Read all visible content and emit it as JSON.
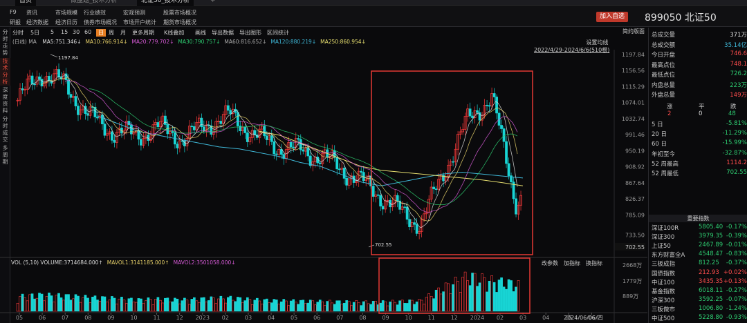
{
  "tabs": [
    {
      "label": "首页",
      "active": true
    },
    {
      "label": "做盘题_技术分析",
      "active": false
    },
    {
      "label": "北证50_技术分析",
      "active": true
    }
  ],
  "menu": {
    "row1": [
      "F9",
      "资讯",
      "市场规模",
      "行业绩效",
      "宏观预测",
      "股票市场概况"
    ],
    "row2": [
      "研报",
      "经济数据",
      "经济日历",
      "债券市场概况",
      "市场开户统计",
      "期货市场概况"
    ]
  },
  "header": {
    "add_label": "加入自选",
    "code": "899050",
    "name": "北证50"
  },
  "left_nav": [
    "分时走势",
    "技术分析",
    "深度资料",
    "分时成交",
    "多周期"
  ],
  "left_nav_active": "技术分析",
  "toolbar": {
    "periods": [
      "分时",
      "5日",
      "5",
      "15",
      "30",
      "60",
      "日",
      "周",
      "月",
      "更多周期",
      "K线叠加",
      "画线",
      "导出数据",
      "导出图形",
      "区间统计"
    ],
    "selected": "日",
    "right": "简约版面"
  },
  "ma_legend": {
    "tag": "(日线) MA",
    "items": [
      {
        "label": "MA5:751.346↓",
        "color": "#dddddd"
      },
      {
        "label": "MA10:766.914↓",
        "color": "#e8d26a"
      },
      {
        "label": "MA20:779.702↓",
        "color": "#d65ad6"
      },
      {
        "label": "MA30:790.757↓",
        "color": "#2ecc71"
      },
      {
        "label": "MA60:816.652↓",
        "color": "#aaaaaa"
      },
      {
        "label": "MA120:880.219↓",
        "color": "#3fb8d8"
      },
      {
        "label": "MA250:860.954↓",
        "color": "#e8e070"
      }
    ]
  },
  "range": {
    "setting": "设置均线",
    "label": "2022/4/29-2024/6/6(510根)"
  },
  "price_axis": [
    "1197.84",
    "1156.56",
    "1115.29",
    "1074.01",
    "1032.74",
    "991.46",
    "950.19",
    "908.92",
    "867.64",
    "826.37",
    "785.09",
    "733.50",
    "702.55"
  ],
  "annotations": {
    "high": "1197.84",
    "low": "702.55"
  },
  "x_axis": [
    "05",
    "06",
    "07",
    "08",
    "09",
    "10",
    "11",
    "12",
    "2023",
    "02",
    "03",
    "04",
    "05",
    "06",
    "07",
    "08",
    "09",
    "10",
    "11",
    "12",
    "2024",
    "02",
    "03",
    "04",
    "05",
    "06"
  ],
  "volume": {
    "legend": [
      {
        "label": "VOL (5,10) VOLUME:3714684.000↑",
        "color": "#dddddd"
      },
      {
        "label": "MAVOL1:3141185.000↑",
        "color": "#e8d26a"
      },
      {
        "label": "MAVOL2:3501058.000↓",
        "color": "#d65ad6"
      }
    ],
    "buttons": [
      "改参数",
      "加指标",
      "换指标"
    ],
    "axis": [
      "2668万",
      "1779万",
      "889万"
    ],
    "date": "2024/06/06/四"
  },
  "quote": [
    {
      "label": "总成交量",
      "value": "371万",
      "color": "#dddddd"
    },
    {
      "label": "总成交额",
      "value": "35.14亿",
      "color": "#3fb8d8"
    },
    {
      "label": "今日开盘",
      "value": "746.6",
      "color": "#ff4d4d"
    },
    {
      "label": "最高点位",
      "value": "748.1",
      "color": "#ff4d4d"
    },
    {
      "label": "最低点位",
      "value": "726.2",
      "color": "#2ecc71"
    },
    {
      "label": "内盘总量",
      "value": "223万",
      "color": "#2ecc71"
    },
    {
      "label": "外盘总量",
      "value": "149万",
      "color": "#ff4d4d"
    }
  ],
  "breadth": {
    "headers": [
      "涨",
      "平",
      "跌"
    ],
    "values": [
      "2",
      "0",
      "48"
    ]
  },
  "perf": [
    {
      "label": "5 日",
      "value": "-5.81%",
      "color": "#2ecc71"
    },
    {
      "label": "20 日",
      "value": "-11.29%",
      "color": "#2ecc71"
    },
    {
      "label": "60 日",
      "value": "-15.99%",
      "color": "#2ecc71"
    },
    {
      "label": "年初至今",
      "value": "-32.87%",
      "color": "#2ecc71"
    },
    {
      "label": "52 周最高",
      "value": "1114.2",
      "color": "#ff4d4d"
    },
    {
      "label": "52 周最低",
      "value": "702.55",
      "color": "#2ecc71"
    }
  ],
  "indices_header": "重要指数",
  "indices": [
    {
      "name": "深证100R",
      "price": "5805.40",
      "chg": "-0.17%",
      "color": "#2ecc71"
    },
    {
      "name": "深证300",
      "price": "3979.35",
      "chg": "-0.39%",
      "color": "#2ecc71"
    },
    {
      "name": "上证50",
      "price": "2467.89",
      "chg": "-0.01%",
      "color": "#2ecc71"
    },
    {
      "name": "东方财富全A",
      "price": "4548.47",
      "chg": "-0.83%",
      "color": "#2ecc71"
    },
    {
      "name": "三板成指",
      "price": "812.25",
      "chg": "-0.37%",
      "color": "#2ecc71"
    },
    {
      "name": "国债指数",
      "price": "212.93",
      "chg": "+0.02%",
      "color": "#ff4d4d"
    },
    {
      "name": "中证100",
      "price": "3435.35",
      "chg": "+0.13%",
      "color": "#ff4d4d"
    },
    {
      "name": "基金指数",
      "price": "6018.11",
      "chg": "-0.27%",
      "color": "#2ecc71"
    },
    {
      "name": "沪深300",
      "price": "3592.25",
      "chg": "-0.07%",
      "color": "#2ecc71"
    },
    {
      "name": "三板做市",
      "price": "1006.80",
      "chg": "-1.24%",
      "color": "#2ecc71"
    },
    {
      "name": "中证500",
      "price": "5228.80",
      "chg": "-0.93%",
      "color": "#2ecc71"
    },
    {
      "name": "中小300",
      "price": "1147.42",
      "chg": "-1.04%",
      "color": "#2ecc71"
    },
    {
      "name": "企债指数",
      "price": "286.70",
      "chg": "+0.02%",
      "color": "#ff4d4d"
    },
    {
      "name": "A股指数",
      "price": "3196.33",
      "chg": "-0.54%",
      "color": "#2ecc71"
    },
    {
      "name": "上证指数",
      "price": "3048.79",
      "chg": "-0.54%",
      "color": "#2ecc71"
    }
  ],
  "chart_data": {
    "type": "candlestick",
    "title": "北证50",
    "period": "日",
    "price_range": [
      702.55,
      1197.84
    ],
    "x": [
      "2022-05",
      "2022-06",
      "2022-07",
      "2022-08",
      "2022-09",
      "2022-10",
      "2022-11",
      "2022-12",
      "2023-01",
      "2023-02",
      "2023-03",
      "2023-04",
      "2023-05",
      "2023-06",
      "2023-07",
      "2023-08",
      "2023-09",
      "2023-10",
      "2023-11",
      "2023-12",
      "2024-01",
      "2024-02",
      "2024-03",
      "2024-04",
      "2024-05",
      "2024-06"
    ],
    "close": [
      1080,
      1150,
      1120,
      1040,
      1000,
      990,
      1010,
      980,
      1020,
      1040,
      990,
      960,
      950,
      930,
      890,
      850,
      800,
      760,
      900,
      1030,
      1090,
      820,
      880,
      850,
      790,
      735
    ],
    "series": [
      {
        "name": "MA120",
        "values": [
          null,
          null,
          null,
          null,
          1040,
          1020,
          1000,
          990,
          980,
          970,
          960,
          955,
          945,
          935,
          920,
          910,
          890,
          870,
          860,
          870,
          880,
          890,
          895,
          890,
          885,
          880
        ]
      },
      {
        "name": "MA250",
        "values": [
          null,
          null,
          null,
          null,
          null,
          null,
          null,
          null,
          null,
          null,
          null,
          null,
          1000,
          990,
          970,
          950,
          930,
          910,
          900,
          895,
          890,
          885,
          880,
          875,
          868,
          860
        ]
      }
    ],
    "volume_unit": "万",
    "volume": [
      900,
      1000,
      950,
      850,
      800,
      700,
      750,
      700,
      780,
      820,
      700,
      650,
      620,
      600,
      580,
      560,
      600,
      650,
      1500,
      2200,
      1900,
      1700,
      1300,
      1100,
      900,
      800
    ]
  }
}
